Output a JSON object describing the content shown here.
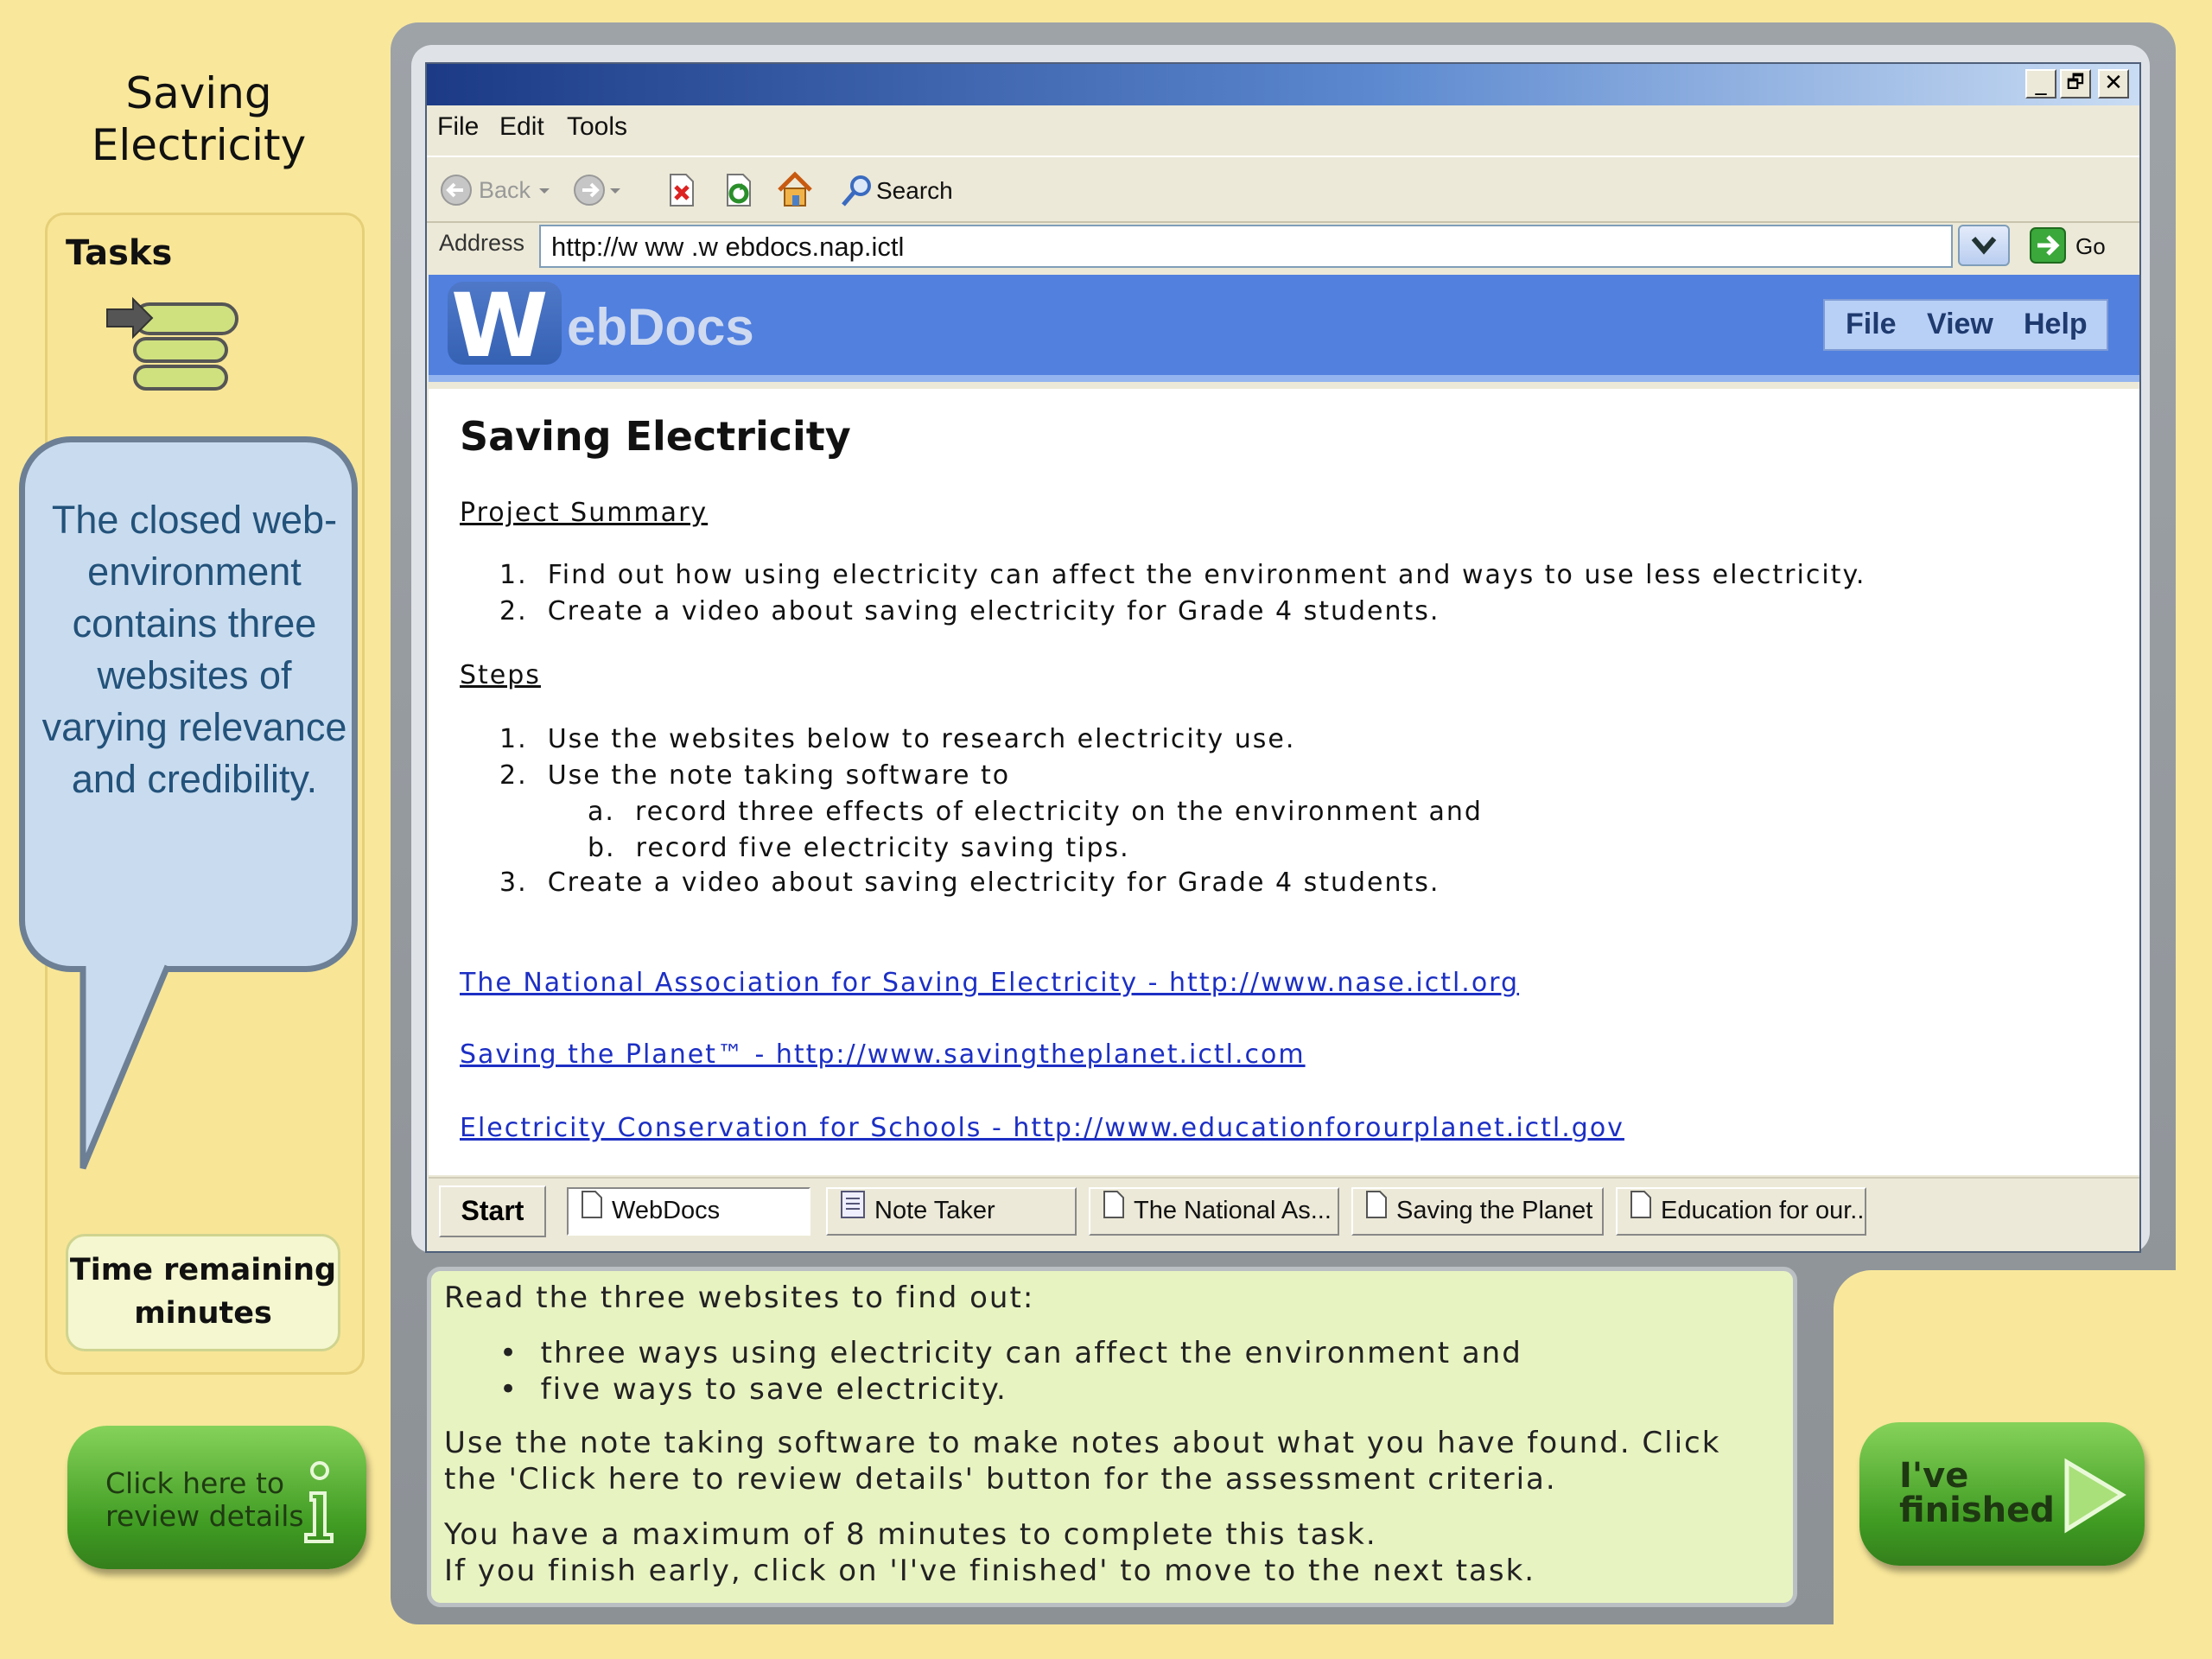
{
  "lesson": {
    "title": "Saving\nElectricity"
  },
  "tasks": {
    "label": "Tasks"
  },
  "callout": {
    "text": "The closed web-environment contains three websites of varying relevance and credibility."
  },
  "timer": {
    "line1": "Time remaining",
    "line2": "minutes"
  },
  "review_button": {
    "label": "Click here to\nreview details",
    "icon": "info-icon"
  },
  "browser": {
    "window_buttons": [
      "_",
      "🗗",
      "✕"
    ],
    "menu": [
      "File",
      "Edit",
      "Tools"
    ],
    "toolbar": {
      "back": "Back",
      "search": "Search"
    },
    "address": {
      "label": "Address",
      "value": "http://w ww .w ebdocs.nap.ictl",
      "go": "Go"
    }
  },
  "webdocs": {
    "logo_letter": "W",
    "logo_text": "ebDocs",
    "menu": [
      "File",
      "View",
      "Help"
    ]
  },
  "document": {
    "title": "Saving Electricity",
    "summary_heading": "Project Summary",
    "summary_items": [
      "1.  Find out how using electricity can affect the environment and ways to use less electricity.",
      "2.  Create a video about saving electricity for Grade 4 students."
    ],
    "steps_heading": "Steps",
    "steps": [
      "1.  Use the websites below to research electricity use.",
      "2.  Use the note taking software to",
      "a.  record three effects of electricity on the environment and",
      "b.  record five electricity saving tips.",
      "3.  Create a video about saving electricity for Grade 4 students."
    ],
    "links": [
      "The National Association for Saving Electricity - http://www.nase.ictl.org",
      "Saving the Planet™ - http://www.savingtheplanet.ictl.com",
      "Electricity Conservation for Schools - http://www.educationforourplanet.ictl.gov"
    ]
  },
  "taskbar": {
    "start": "Start",
    "items": [
      "WebDocs",
      "Note Taker",
      "The National As...",
      "Saving the Planet",
      "Education for our..."
    ]
  },
  "instructions": {
    "intro": "Read the three websites to find out:",
    "bullets": [
      "three ways using electricity can affect the environment and",
      "five ways to save electricity."
    ],
    "para1_line1": "Use the note taking software to make notes about what you have found. Click",
    "para1_line2": "the 'Click here to review details' button for the assessment criteria.",
    "para2_line1": "You have a maximum of 8 minutes to complete this task.",
    "para2_line2": "If you finish early, click on 'I've finished' to move to the next task."
  },
  "finished_button": {
    "label": "I've\nfinished",
    "icon": "play-arrow-icon"
  },
  "colors": {
    "background": "#f9e89b",
    "accent_green": "#3f9b22",
    "webdocs_blue": "#5180df",
    "link": "#1c2fc4"
  }
}
